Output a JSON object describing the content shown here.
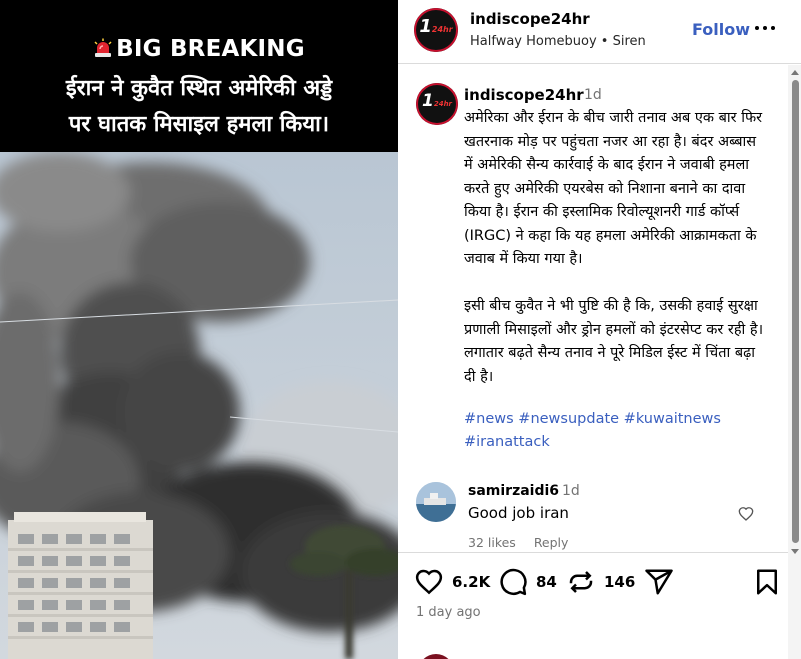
{
  "media": {
    "banner_line1": "BIG BREAKING",
    "banner_line2": "ईरान ने कुवैत स्थित अमेरिकी अड्डे",
    "banner_line3": "पर घातक मिसाइल हमला किया।",
    "alert_icon": "siren-emoji"
  },
  "header": {
    "username": "indiscope24hr",
    "audio_track": "Halfway Homebuoy • Siren",
    "follow_label": "Follow",
    "more_icon": "more-horizontal-icon",
    "avatar_logo": "1",
    "avatar_logo_sub": "24hr"
  },
  "post": {
    "username": "indiscope24hr",
    "time": "1d",
    "caption": "अमेरिका और ईरान के बीच जारी तनाव अब एक बार फिर खतरनाक मोड़ पर पहुंचता नजर आ रहा है। बंदर अब्बास में अमेरिकी सैन्य कार्रवाई के बाद ईरान ने जवाबी हमला करते हुए अमेरिकी एयरबेस को निशाना बनाने का दावा किया है। ईरान की इस्लामिक रिवोल्यूशनरी गार्ड कॉर्प्स (IRGC) ने कहा कि यह हमला अमेरिकी आक्रामकता के जवाब में किया गया है।\n\nइसी बीच कुवैत ने भी पुष्टि की है कि, उसकी हवाई सुरक्षा प्रणाली मिसाइलों और ड्रोन हमलों को इंटरसेप्ट कर रही है। लगातार बढ़ते सैन्य तनाव ने पूरे मिडिल ईस्ट में चिंता बढ़ा दी है।",
    "hashtags": [
      "#news",
      "#newsupdate",
      "#kuwaitnews",
      "#iranattack"
    ]
  },
  "comment": {
    "username": "samirzaidi6",
    "time": "1d",
    "text": "Good job iran",
    "likes": "32 likes",
    "reply_label": "Reply"
  },
  "actions": {
    "likes": "6.2K",
    "comments": "84",
    "reposts": "146",
    "posted_ago": "1 day ago"
  }
}
